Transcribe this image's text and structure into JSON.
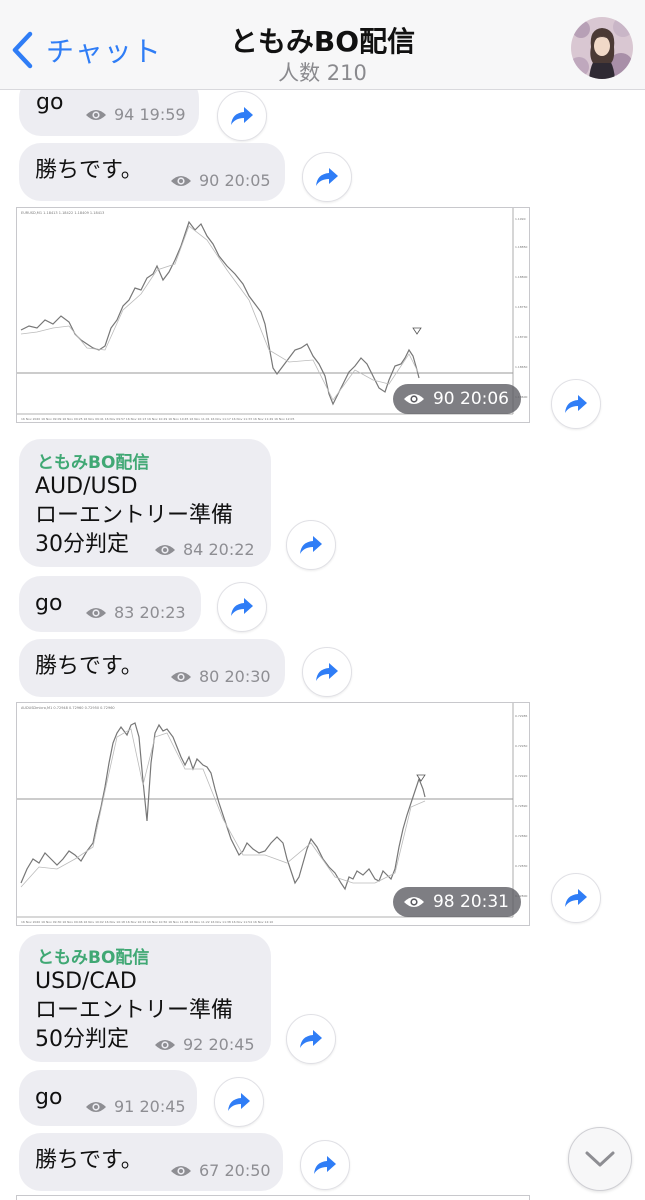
{
  "header": {
    "back_label": "チャット",
    "title": "ともみBO配信",
    "subtitle": "人数 210"
  },
  "messages": [
    {
      "text": "go",
      "views": "94",
      "time": "19:59"
    },
    {
      "text": "勝ちです。",
      "views": "90",
      "time": "20:05"
    },
    {
      "type": "image",
      "views": "90",
      "time": "20:06"
    },
    {
      "sender": "ともみBO配信",
      "lines": [
        "AUD/USD",
        "ローエントリー準備",
        "30分判定"
      ],
      "views": "84",
      "time": "20:22"
    },
    {
      "text": "go",
      "views": "83",
      "time": "20:23"
    },
    {
      "text": "勝ちです。",
      "views": "80",
      "time": "20:30"
    },
    {
      "type": "image",
      "views": "98",
      "time": "20:31"
    },
    {
      "sender": "ともみBO配信",
      "lines": [
        "USD/CAD",
        "ローエントリー準備",
        "50分判定"
      ],
      "views": "92",
      "time": "20:45"
    },
    {
      "text": "go",
      "views": "91",
      "time": "20:45"
    },
    {
      "text": "勝ちです。",
      "views": "67",
      "time": "20:50"
    }
  ],
  "colors": {
    "accent": "#2f7df6",
    "sender": "#40a874",
    "bubble": "#ededf2",
    "meta": "#8e8e93"
  },
  "icons": {
    "back": "chevron-left-icon",
    "views": "eye-icon",
    "share": "share-arrow-icon",
    "scroll": "chevron-down-icon"
  }
}
